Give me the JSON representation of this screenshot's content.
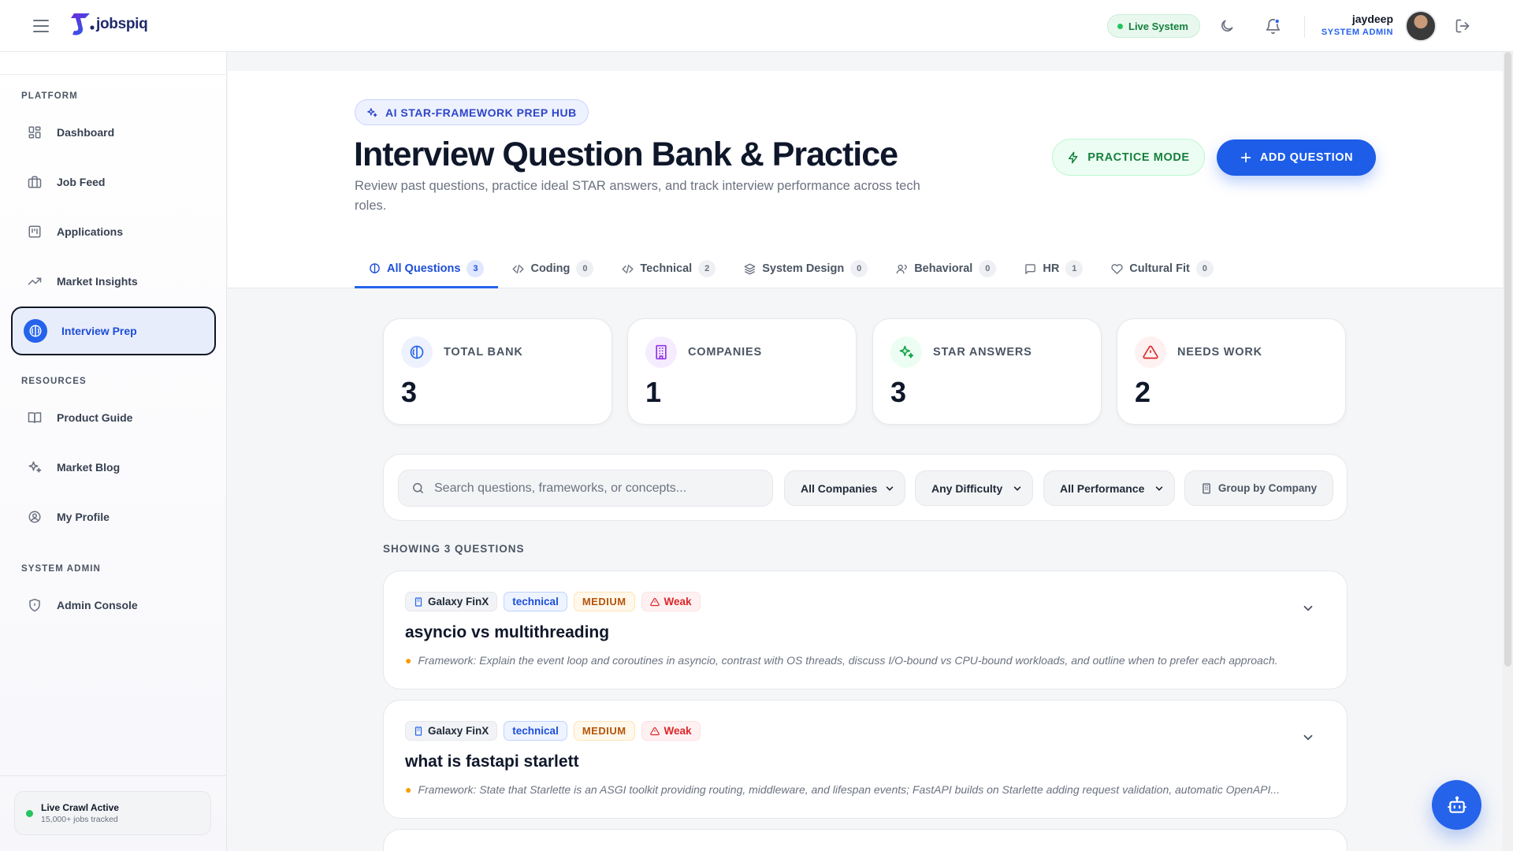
{
  "header": {
    "logo_text": "jobspiq",
    "status_pill": "Live System",
    "user_name": "jaydeep",
    "user_role": "SYSTEM ADMIN",
    "icons": [
      "menu-icon",
      "moon-icon",
      "bell-icon",
      "logout-icon"
    ],
    "notification_color": "#2563eb"
  },
  "sidebar": {
    "sections": {
      "platform": "PLATFORM",
      "resources": "RESOURCES",
      "admin": "SYSTEM ADMIN"
    },
    "items": [
      {
        "label": "Dashboard",
        "icon": "grid-icon"
      },
      {
        "label": "Job Feed",
        "icon": "briefcase-icon"
      },
      {
        "label": "Applications",
        "icon": "kanban-icon"
      },
      {
        "label": "Market Insights",
        "icon": "trending-up-icon"
      },
      {
        "label": "Interview Prep",
        "icon": "brain-icon",
        "active": true
      },
      {
        "label": "Product Guide",
        "icon": "book-icon"
      },
      {
        "label": "Market Blog",
        "icon": "sparkles-icon"
      },
      {
        "label": "My Profile",
        "icon": "user-circle-icon"
      },
      {
        "label": "Admin Console",
        "icon": "shield-icon"
      }
    ],
    "crawl": {
      "title": "Live Crawl Active",
      "subtitle": "15,000+ jobs tracked"
    }
  },
  "hero": {
    "badge": "AI STAR-FRAMEWORK PREP HUB",
    "title": "Interview Question Bank & Practice",
    "subtitle": "Review past questions, practice ideal STAR answers, and track interview performance across tech roles.",
    "practice_label": "PRACTICE MODE",
    "add_label": "ADD QUESTION"
  },
  "tabs": [
    {
      "label": "All Questions",
      "count": "3",
      "icon": "brain-icon",
      "active": true
    },
    {
      "label": "Coding",
      "count": "0",
      "icon": "code-icon"
    },
    {
      "label": "Technical",
      "count": "2",
      "icon": "code-icon"
    },
    {
      "label": "System Design",
      "count": "0",
      "icon": "layers-icon"
    },
    {
      "label": "Behavioral",
      "count": "0",
      "icon": "users-icon"
    },
    {
      "label": "HR",
      "count": "1",
      "icon": "message-icon"
    },
    {
      "label": "Cultural Fit",
      "count": "0",
      "icon": "heart-icon"
    }
  ],
  "stats": [
    {
      "label": "TOTAL BANK",
      "value": "3",
      "icon": "brain-icon",
      "color": "#2563eb"
    },
    {
      "label": "COMPANIES",
      "value": "1",
      "icon": "building-icon",
      "color": "#9333ea"
    },
    {
      "label": "STAR ANSWERS",
      "value": "3",
      "icon": "sparkles-icon",
      "color": "#16a34a"
    },
    {
      "label": "NEEDS WORK",
      "value": "2",
      "icon": "alert-triangle-icon",
      "color": "#dc2626"
    }
  ],
  "filters": {
    "search_placeholder": "Search questions, frameworks, or concepts...",
    "company": "All Companies",
    "difficulty": "Any Difficulty",
    "performance": "All Performance",
    "group_label": "Group by Company"
  },
  "showing": "SHOWING 3 QUESTIONS",
  "questions": [
    {
      "company": "Galaxy FinX",
      "type": "technical",
      "difficulty": "MEDIUM",
      "performance": "Weak",
      "title": "asyncio vs multithreading",
      "framework": "Framework: Explain the event loop and coroutines in asyncio, contrast with OS threads, discuss I/O-bound vs CPU-bound workloads, and outline when to prefer each approach."
    },
    {
      "company": "Galaxy FinX",
      "type": "technical",
      "difficulty": "MEDIUM",
      "performance": "Weak",
      "title": "what is fastapi starlett",
      "framework": "Framework: State that Starlette is an ASGI toolkit providing routing, middleware, and lifespan events; FastAPI builds on Starlette adding request validation, automatic OpenAPI..."
    }
  ]
}
